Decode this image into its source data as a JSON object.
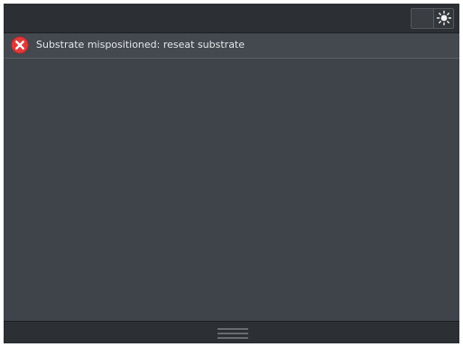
{
  "alert": {
    "severity": "error",
    "icon": "error-x-icon",
    "message": "Substrate mispositioned: reseat substrate"
  },
  "top_bar": {
    "toggle_icon": "sun-icon"
  },
  "bottom_bar": {
    "handle_icon": "drawer-handle-icon"
  },
  "colors": {
    "background": "#3f434a",
    "bar": "#2c2f33",
    "error": "#e03a3a",
    "text": "#e4e6e9"
  }
}
